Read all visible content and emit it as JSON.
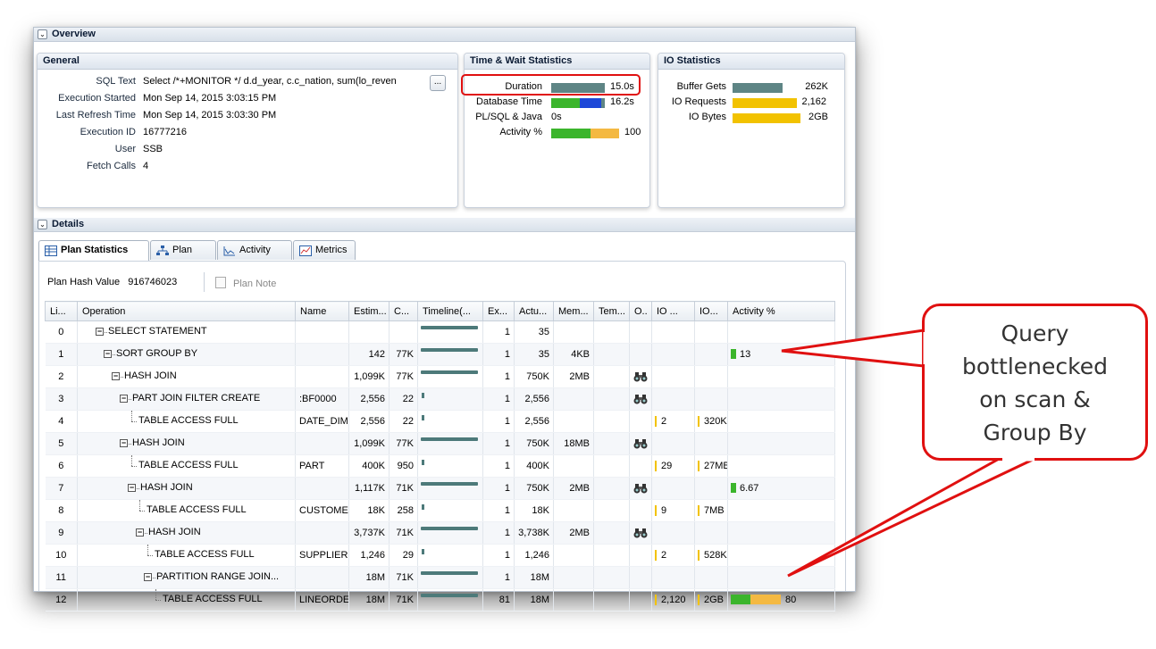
{
  "overview": {
    "section_label": "Overview",
    "general": {
      "title": "General",
      "rows": [
        {
          "label": "SQL Text",
          "value": "Select /*+MONITOR */ d.d_year, c.c_nation, sum(lo_reven"
        },
        {
          "label": "Execution Started",
          "value": "Mon Sep 14, 2015 3:03:15 PM"
        },
        {
          "label": "Last Refresh Time",
          "value": "Mon Sep 14, 2015 3:03:30 PM"
        },
        {
          "label": "Execution ID",
          "value": "16777216"
        },
        {
          "label": "User",
          "value": "SSB"
        },
        {
          "label": "Fetch Calls",
          "value": "4"
        }
      ],
      "more_button": "..."
    },
    "time_wait": {
      "title": "Time & Wait Statistics",
      "rows": [
        {
          "label": "Duration",
          "value": "15.0s"
        },
        {
          "label": "Database Time",
          "value": "16.2s"
        },
        {
          "label": "PL/SQL & Java",
          "value": "0s"
        },
        {
          "label": "Activity %",
          "value": "100"
        }
      ]
    },
    "io_stats": {
      "title": "IO Statistics",
      "rows": [
        {
          "label": "Buffer Gets",
          "value": "262K"
        },
        {
          "label": "IO Requests",
          "value": "2,162"
        },
        {
          "label": "IO Bytes",
          "value": "2GB"
        }
      ]
    }
  },
  "details": {
    "section_label": "Details",
    "tabs": [
      {
        "label": "Plan Statistics",
        "icon": "table-icon",
        "active": true
      },
      {
        "label": "Plan",
        "icon": "tree-icon",
        "active": false
      },
      {
        "label": "Activity",
        "icon": "activity-chart-icon",
        "active": false
      },
      {
        "label": "Metrics",
        "icon": "metrics-chart-icon",
        "active": false
      }
    ],
    "plan_hash_label": "Plan Hash Value",
    "plan_hash_value": "916746023",
    "plan_note_label": "Plan Note",
    "columns": [
      "Li...",
      "Operation",
      "Name",
      "Estim...",
      "C...",
      "Timeline(...",
      "Ex...",
      "Actu...",
      "Mem...",
      "Tem...",
      "O..",
      "IO ...",
      "IO...",
      "Activity %"
    ],
    "rows": [
      {
        "line": "0",
        "op": "SELECT STATEMENT",
        "depth": 0,
        "expander": true,
        "name": "",
        "est": "",
        "cost": "",
        "timeline": "long",
        "exec": "1",
        "actual": "35",
        "mem": "",
        "temp": "",
        "bino": false,
        "io_req": "",
        "io_bytes": "",
        "activity": ""
      },
      {
        "line": "1",
        "op": "SORT GROUP BY",
        "depth": 1,
        "expander": true,
        "name": "",
        "est": "142",
        "cost": "77K",
        "timeline": "long",
        "exec": "1",
        "actual": "35",
        "mem": "4KB",
        "temp": "",
        "bino": false,
        "io_req": "",
        "io_bytes": "",
        "activity": "13"
      },
      {
        "line": "2",
        "op": "HASH JOIN",
        "depth": 2,
        "expander": true,
        "name": "",
        "est": "1,099K",
        "cost": "77K",
        "timeline": "long",
        "exec": "1",
        "actual": "750K",
        "mem": "2MB",
        "temp": "",
        "bino": true,
        "io_req": "",
        "io_bytes": "",
        "activity": ""
      },
      {
        "line": "3",
        "op": "PART JOIN FILTER CREATE",
        "depth": 3,
        "expander": true,
        "name": ":BF0000",
        "est": "2,556",
        "cost": "22",
        "timeline": "tick",
        "exec": "1",
        "actual": "2,556",
        "mem": "",
        "temp": "",
        "bino": true,
        "io_req": "",
        "io_bytes": "",
        "activity": ""
      },
      {
        "line": "4",
        "op": "TABLE ACCESS FULL",
        "depth": 4,
        "expander": false,
        "name": "DATE_DIM",
        "est": "2,556",
        "cost": "22",
        "timeline": "tick",
        "exec": "1",
        "actual": "2,556",
        "mem": "",
        "temp": "",
        "bino": false,
        "io_req": "2",
        "io_bytes": "320KB",
        "activity": ""
      },
      {
        "line": "5",
        "op": "HASH JOIN",
        "depth": 3,
        "expander": true,
        "name": "",
        "est": "1,099K",
        "cost": "77K",
        "timeline": "long",
        "exec": "1",
        "actual": "750K",
        "mem": "18MB",
        "temp": "",
        "bino": true,
        "io_req": "",
        "io_bytes": "",
        "activity": ""
      },
      {
        "line": "6",
        "op": "TABLE ACCESS FULL",
        "depth": 4,
        "expander": false,
        "name": "PART",
        "est": "400K",
        "cost": "950",
        "timeline": "tick",
        "exec": "1",
        "actual": "400K",
        "mem": "",
        "temp": "",
        "bino": false,
        "io_req": "29",
        "io_bytes": "27MB",
        "activity": ""
      },
      {
        "line": "7",
        "op": "HASH JOIN",
        "depth": 4,
        "expander": true,
        "name": "",
        "est": "1,117K",
        "cost": "71K",
        "timeline": "long",
        "exec": "1",
        "actual": "750K",
        "mem": "2MB",
        "temp": "",
        "bino": true,
        "io_req": "",
        "io_bytes": "",
        "activity": "6.67"
      },
      {
        "line": "8",
        "op": "TABLE ACCESS FULL",
        "depth": 5,
        "expander": false,
        "name": "CUSTOMEI",
        "est": "18K",
        "cost": "258",
        "timeline": "tick",
        "exec": "1",
        "actual": "18K",
        "mem": "",
        "temp": "",
        "bino": false,
        "io_req": "9",
        "io_bytes": "7MB",
        "activity": ""
      },
      {
        "line": "9",
        "op": "HASH JOIN",
        "depth": 5,
        "expander": true,
        "name": "",
        "est": "3,737K",
        "cost": "71K",
        "timeline": "long",
        "exec": "1",
        "actual": "3,738K",
        "mem": "2MB",
        "temp": "",
        "bino": true,
        "io_req": "",
        "io_bytes": "",
        "activity": ""
      },
      {
        "line": "10",
        "op": "TABLE ACCESS FULL",
        "depth": 6,
        "expander": false,
        "name": "SUPPLIER",
        "est": "1,246",
        "cost": "29",
        "timeline": "tick",
        "exec": "1",
        "actual": "1,246",
        "mem": "",
        "temp": "",
        "bino": false,
        "io_req": "2",
        "io_bytes": "528KB",
        "activity": ""
      },
      {
        "line": "11",
        "op": "PARTITION RANGE JOIN...",
        "depth": 6,
        "expander": true,
        "name": "",
        "est": "18M",
        "cost": "71K",
        "timeline": "long",
        "exec": "1",
        "actual": "18M",
        "mem": "",
        "temp": "",
        "bino": false,
        "io_req": "",
        "io_bytes": "",
        "activity": ""
      },
      {
        "line": "12",
        "op": "TABLE ACCESS FULL",
        "depth": 7,
        "expander": false,
        "name": "LINEORDE",
        "est": "18M",
        "cost": "71K",
        "timeline": "long",
        "exec": "81",
        "actual": "18M",
        "mem": "",
        "temp": "",
        "bino": false,
        "io_req": "2,120",
        "io_bytes": "2GB",
        "activity": "80"
      }
    ]
  },
  "callout": {
    "lines": [
      "Query",
      "bottlenecked",
      "on scan &",
      "Group By"
    ]
  },
  "colors": {
    "annotation_red": "#e01010",
    "duration_bar": "#5e8585",
    "db_time_green": "#3bb52c",
    "db_time_blue": "#1d48d8",
    "io_yellow": "#f2c200",
    "activity_green": "#3bb52c",
    "activity_orange": "#f4b942",
    "timeline_teal": "#4d7a7a"
  }
}
